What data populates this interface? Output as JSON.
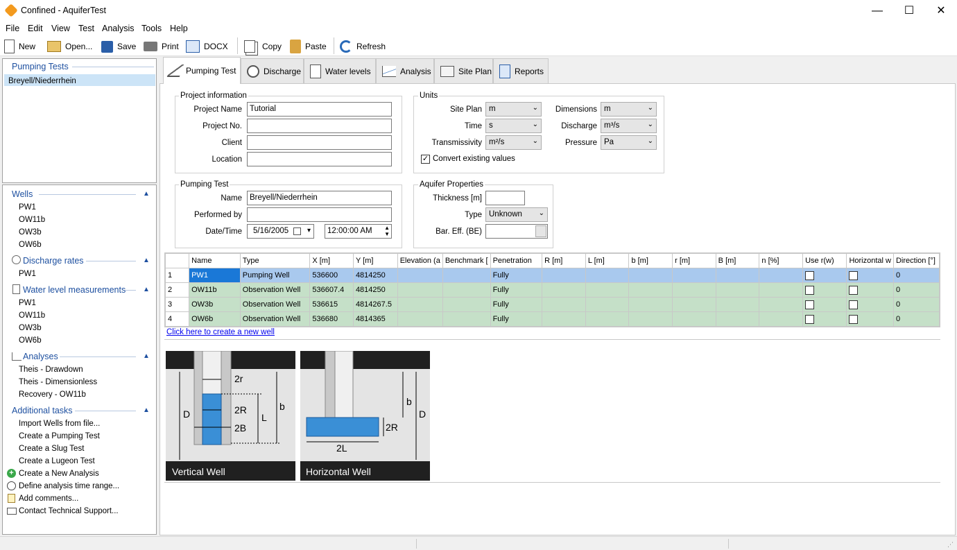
{
  "window": {
    "title": "Confined - AquiferTest",
    "minimize": "—",
    "maximize": "☐",
    "close": "✕"
  },
  "menu": [
    "File",
    "Edit",
    "View",
    "Test",
    "Analysis",
    "Tools",
    "Help"
  ],
  "toolbar": {
    "new": "New",
    "open": "Open...",
    "save": "Save",
    "print": "Print",
    "docx": "DOCX",
    "copy": "Copy",
    "paste": "Paste",
    "refresh": "Refresh"
  },
  "pumping_tests": {
    "header": "Pumping Tests",
    "items": [
      "Breyell/Niederrhein"
    ]
  },
  "nav": {
    "wells": {
      "header": "Wells",
      "items": [
        "PW1",
        "OW11b",
        "OW3b",
        "OW6b"
      ]
    },
    "discharge": {
      "header": "Discharge rates",
      "items": [
        "PW1"
      ]
    },
    "water": {
      "header": "Water level measurements",
      "items": [
        "PW1",
        "OW11b",
        "OW3b",
        "OW6b"
      ]
    },
    "analyses": {
      "header": "Analyses",
      "items": [
        "Theis - Drawdown",
        "Theis - Dimensionless",
        "Recovery - OW11b"
      ]
    },
    "tasks": {
      "header": "Additional tasks",
      "items": [
        "Import Wells from file...",
        "Create a Pumping Test",
        "Create a Slug Test",
        "Create a Lugeon Test"
      ],
      "icon_items": [
        "Create a New Analysis",
        "Define analysis time range...",
        "Add comments...",
        "Contact Technical Support..."
      ]
    }
  },
  "tabs": [
    "Pumping Test",
    "Discharge",
    "Water levels",
    "Analysis",
    "Site Plan",
    "Reports"
  ],
  "project": {
    "group": "Project information",
    "name_label": "Project Name",
    "name": "Tutorial",
    "no_label": "Project No.",
    "no": "",
    "client_label": "Client",
    "client": "",
    "location_label": "Location",
    "location": ""
  },
  "units": {
    "group": "Units",
    "site_plan_label": "Site Plan",
    "site_plan": "m",
    "time_label": "Time",
    "time": "s",
    "transmissivity_label": "Transmissivity",
    "transmissivity": "m²/s",
    "dimensions_label": "Dimensions",
    "dimensions": "m",
    "discharge_label": "Discharge",
    "discharge": "m³/s",
    "pressure_label": "Pressure",
    "pressure": "Pa",
    "convert": "Convert existing values"
  },
  "pumping_test": {
    "group": "Pumping Test",
    "name_label": "Name",
    "name": "Breyell/Niederrhein",
    "performed_label": "Performed by",
    "performed": "",
    "datetime_label": "Date/Time",
    "date": "5/16/2005",
    "time": "12:00:00 AM"
  },
  "aquifer": {
    "group": "Aquifer Properties",
    "thickness_label": "Thickness [m]",
    "thickness": "",
    "type_label": "Type",
    "type": "Unknown",
    "bareff_label": "Bar. Eff. (BE)",
    "bareff": ""
  },
  "wells_table": {
    "columns": [
      "Name",
      "Type",
      "X [m]",
      "Y [m]",
      "Elevation (a",
      "Benchmark [",
      "Penetration",
      "R [m]",
      "L [m]",
      "b [m]",
      "r [m]",
      "B [m]",
      "n [%]",
      "Use r(w)",
      "Horizontal w",
      "Direction [°]"
    ],
    "rows": [
      {
        "n": "1",
        "name": "PW1",
        "type": "Pumping Well",
        "x": "536600",
        "y": "4814250",
        "pen": "Fully",
        "dir": "0"
      },
      {
        "n": "2",
        "name": "OW11b",
        "type": "Observation Well",
        "x": "536607.4",
        "y": "4814250",
        "pen": "Fully",
        "dir": "0"
      },
      {
        "n": "3",
        "name": "OW3b",
        "type": "Observation Well",
        "x": "536615",
        "y": "4814267.5",
        "pen": "Fully",
        "dir": "0"
      },
      {
        "n": "4",
        "name": "OW6b",
        "type": "Observation Well",
        "x": "536680",
        "y": "4814365",
        "pen": "Fully",
        "dir": "0"
      }
    ],
    "create_link": "Click here to create a new well"
  },
  "diagrams": {
    "vertical": {
      "title": "Vertical Well",
      "r": "2r",
      "R": "2R",
      "B": "2B",
      "L": "L",
      "b": "b",
      "D": "D"
    },
    "horizontal": {
      "title": "Horizontal Well",
      "b": "b",
      "R": "2R",
      "L": "2L",
      "D": "D"
    }
  },
  "colors": {
    "accent": "#1e50a0",
    "selected_row": "#a9c9ee",
    "obs_row": "#c5e0c8",
    "well_fill": "#3a8fd6"
  }
}
